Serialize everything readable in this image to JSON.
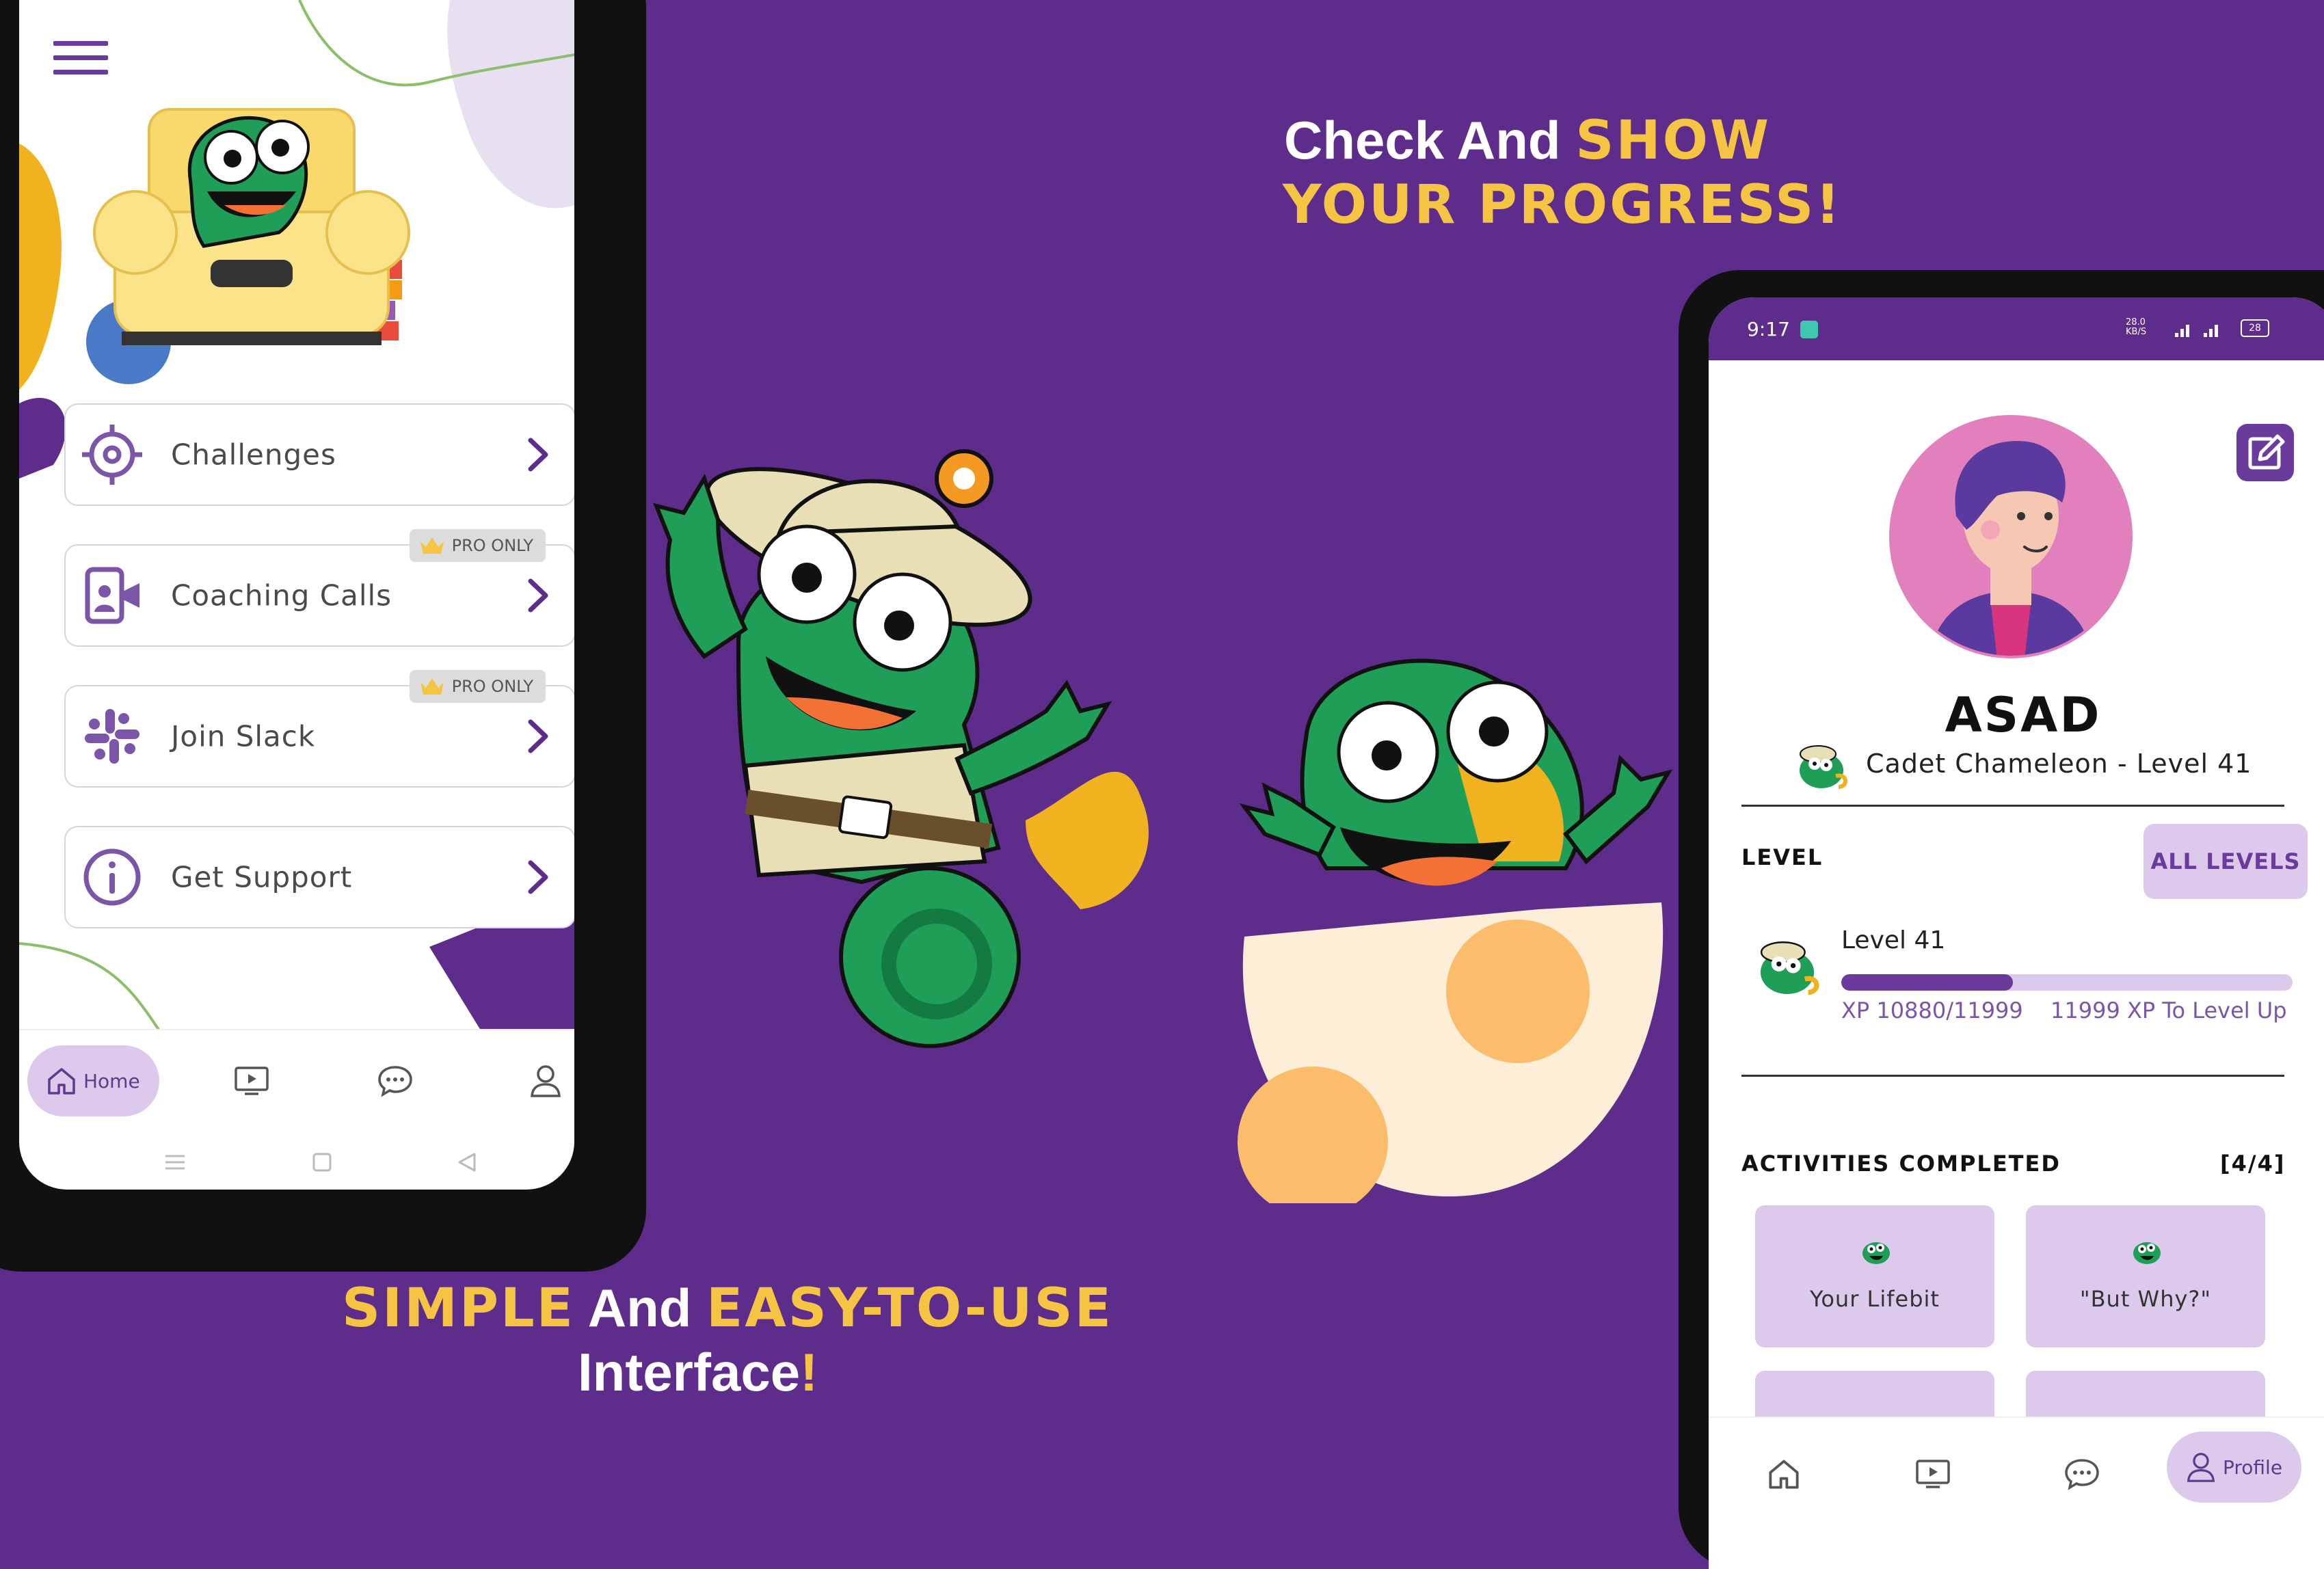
{
  "headline_top": {
    "part1": "Check And ",
    "part2": "SHOW",
    "line2": "YOUR PROGRESS!"
  },
  "headline_bottom": {
    "part1": "SIMPLE",
    "part2": " And ",
    "part3": "EASY-TO-USE",
    "line2_text": "Interface",
    "line2_excl": "!"
  },
  "left_app": {
    "menu": [
      {
        "label": "Challenges",
        "icon": "target-icon",
        "badge": ""
      },
      {
        "label": "Coaching Calls",
        "icon": "video-call-icon",
        "badge": "PRO ONLY"
      },
      {
        "label": "Join Slack",
        "icon": "slack-icon",
        "badge": "PRO ONLY"
      },
      {
        "label": "Get Support",
        "icon": "info-icon",
        "badge": ""
      }
    ],
    "nav": {
      "home_label": "Home"
    }
  },
  "right_app": {
    "status_bar": {
      "time": "9:17",
      "speed": "28.0 KB/S",
      "battery": "28"
    },
    "profile": {
      "name": "ASAD",
      "rank": "Cadet Chameleon - Level 41"
    },
    "level_section": {
      "title": "LEVEL",
      "all_levels_button": "ALL LEVELS",
      "level_label": "Level 41",
      "xp_current": "XP 10880/11999",
      "xp_to_level": "11999 XP To Level Up",
      "progress": 0.38
    },
    "activities": {
      "title": "ACTIVITIES COMPLETED",
      "count": "[4/4]",
      "cards": [
        "Your Lifebit",
        "\"But Why?\""
      ]
    },
    "nav": {
      "profile_label": "Profile"
    }
  },
  "colors": {
    "background": "#5e2d8c",
    "accent_yellow": "#f6c443",
    "brand_purple": "#6a3a9c",
    "chip_lilac": "#dcc9ec",
    "chameleon_green": "#1f9e57"
  }
}
